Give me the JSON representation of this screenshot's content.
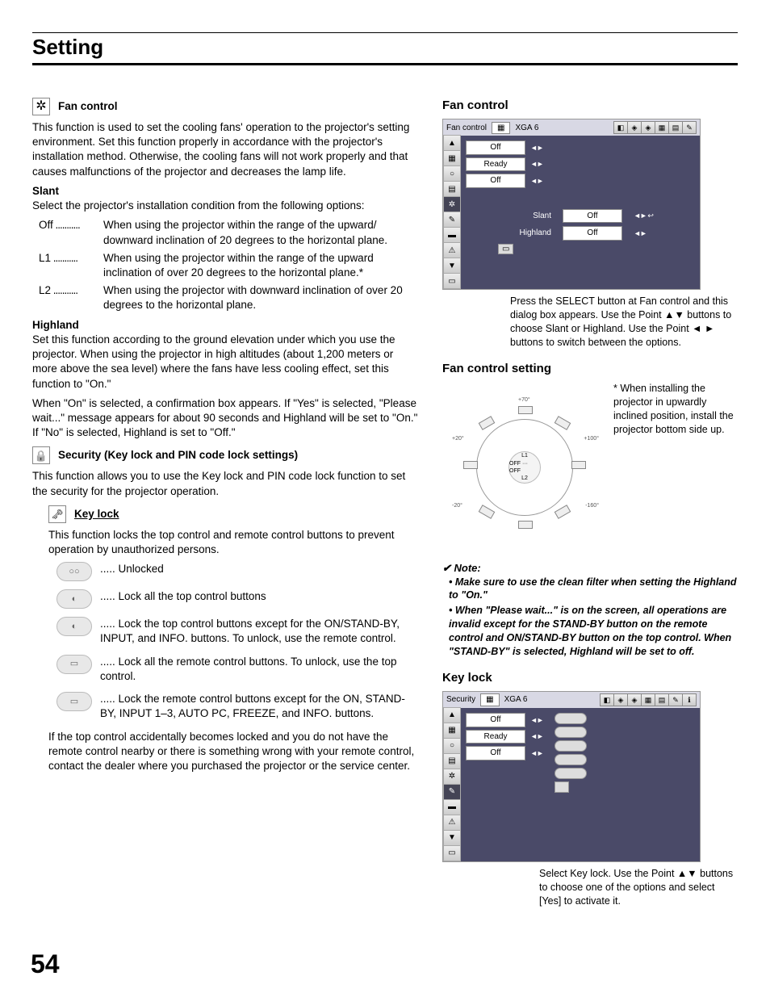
{
  "page": {
    "header": "Setting",
    "number": "54"
  },
  "fan_control": {
    "heading": "Fan control",
    "intro": "This function is used to set the cooling fans' operation to the projector's setting environment. Set this function properly in accordance with the projector's installation method. Otherwise, the cooling fans will not work properly and that causes malfunctions of the projector and decreases the lamp life.",
    "slant": {
      "head": "Slant",
      "intro": "Select the projector's installation condition from the following options:",
      "opts": [
        {
          "key": "Off",
          "desc": "When using the projector within the range of the upward/ downward inclination of 20 degrees to the horizontal plane."
        },
        {
          "key": "L1",
          "desc": "When using the projector within the range of the upward inclination of over 20 degrees to the horizontal plane.*"
        },
        {
          "key": "L2",
          "desc": "When using the projector with downward inclination of over 20 degrees to the horizontal plane."
        }
      ]
    },
    "highland": {
      "head": "Highland",
      "p1": "Set this function according to the ground elevation under which you use the projector. When using the projector in high altitudes (about 1,200 meters or more above the sea level) where the fans have less cooling effect, set this function to \"On.\"",
      "p2": "When \"On\" is selected, a confirmation box appears. If \"Yes\" is selected, \"Please wait...\" message appears for about 90 seconds and Highland will be set to \"On.\" If \"No\" is selected, Highland is set to \"Off.\""
    }
  },
  "security": {
    "heading": "Security (Key lock and PIN code lock settings)",
    "intro": "This function allows you to use the Key lock and PIN code lock function to set the security for the projector operation.",
    "keylock": {
      "heading": "Key lock",
      "intro": "This function locks the top control and remote control buttons to prevent operation by unauthorized persons.",
      "opts": [
        {
          "desc": "Unlocked"
        },
        {
          "desc": "Lock all the top control buttons"
        },
        {
          "desc": "Lock the top control buttons except for the ON/STAND-BY, INPUT, and INFO. buttons. To unlock, use the remote control."
        },
        {
          "desc": "Lock all the remote control buttons. To unlock, use the top control."
        },
        {
          "desc": "Lock the remote control buttons except for the ON, STAND-BY, INPUT 1–3, AUTO PC, FREEZE, and INFO. buttons."
        }
      ],
      "footer": "If the top control accidentally becomes locked and you do not have the remote control nearby or there is something wrong with your remote control, contact the dealer where you purchased the projector or the service center."
    }
  },
  "right": {
    "fan_head": "Fan control",
    "osd1": {
      "title": "Fan control",
      "mode": "XGA 6",
      "rows": [
        "Off",
        "Ready",
        "Off"
      ],
      "sub": [
        {
          "label": "Slant",
          "val": "Off"
        },
        {
          "label": "Highland",
          "val": "Off"
        }
      ]
    },
    "caption1": "Press the SELECT button at Fan control and this dialog box appears. Use the Point ▲▼ buttons to choose Slant or Highland. Use the Point ◄ ► buttons to switch between the options.",
    "setting_head": "Fan control setting",
    "diagram_labels": {
      "t": "+70°",
      "tr": "+100°",
      "r": "",
      "br": "-160°",
      "b": "",
      "bl": "-20°",
      "l": "",
      "tl": "+20°",
      "c_top": "L1",
      "c_mid": "OFF ··· OFF",
      "c_bot": "L2"
    },
    "setting_note": "* When installing the projector in upwardly inclined position, install the projector bottom side up.",
    "note_head": "Note:",
    "notes": [
      "Make sure to use the clean filter when setting the Highland to \"On.\"",
      "When \"Please wait...\" is on the screen, all operations are invalid except for the STAND-BY button on the remote control and ON/STAND-BY button on the top control. When \"STAND-BY\" is selected, Highland will be set to off."
    ],
    "keylock_head": "Key lock",
    "osd2": {
      "title": "Security",
      "mode": "XGA 6",
      "rows": [
        "Off",
        "Ready",
        "Off"
      ]
    },
    "caption2": "Select Key lock. Use the Point ▲▼ buttons to choose one of the options and select [Yes] to activate it."
  }
}
